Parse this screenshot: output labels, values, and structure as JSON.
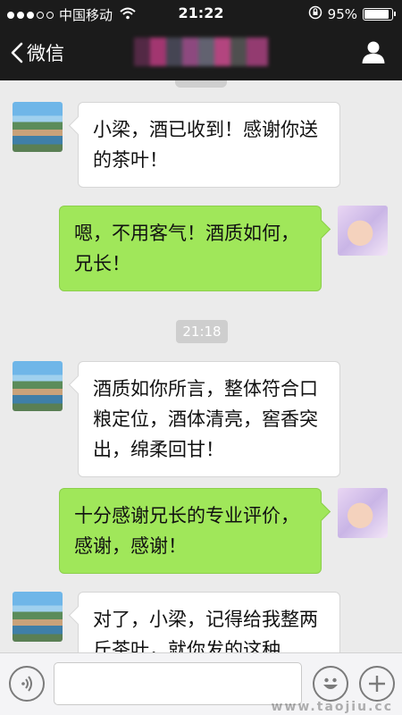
{
  "status_bar": {
    "carrier": "中国移动",
    "time": "21:22",
    "battery": "95%"
  },
  "nav": {
    "back_label": "微信",
    "title_obscured": true
  },
  "chat": {
    "timestamp": "21:18",
    "messages": [
      {
        "side": "left",
        "avatar": "city-avatar",
        "text": "小梁，酒已收到！感谢你送的茶叶！"
      },
      {
        "side": "right",
        "avatar": "baby-avatar",
        "text": "嗯，不用客气！酒质如何，兄长！"
      },
      {
        "side": "left",
        "avatar": "city-avatar",
        "text": "酒质如你所言，整体符合口粮定位，酒体清亮，窖香突出，绵柔回甘！"
      },
      {
        "side": "right",
        "avatar": "baby-avatar",
        "text": "十分感谢兄长的专业评价，感谢，感谢！"
      },
      {
        "side": "left",
        "avatar": "city-avatar",
        "text": "对了，小梁，记得给我整两斤茶叶，就你发的这种"
      }
    ]
  },
  "input_bar": {
    "value": "",
    "placeholder": "",
    "voice_icon": "voice-icon",
    "emoji_icon": "emoji-icon",
    "plus_icon": "plus-icon",
    "watermark": "www.taojiu.cc"
  },
  "colors": {
    "header_bg": "#1b1b1b",
    "chat_bg": "#ebebeb",
    "sent_bubble": "#a0e75a",
    "received_bubble": "#ffffff"
  }
}
